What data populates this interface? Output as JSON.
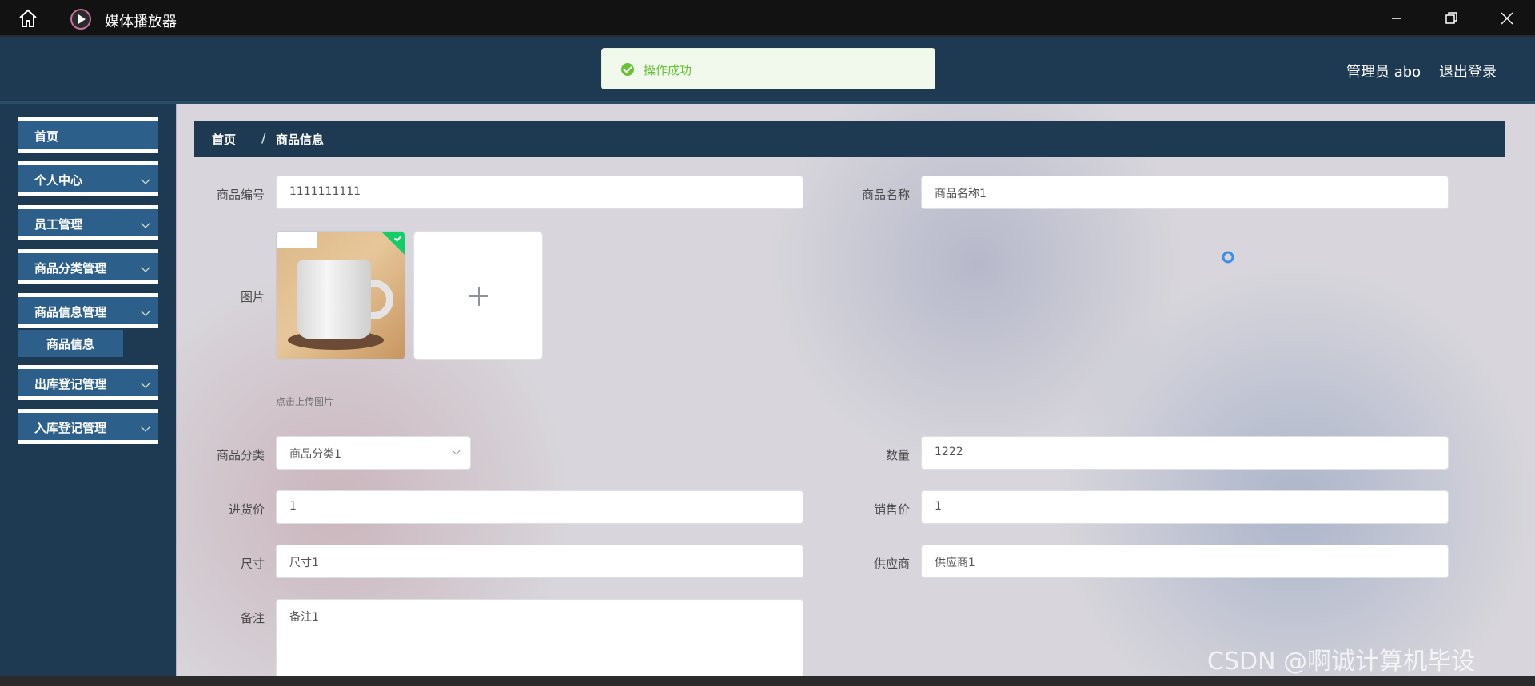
{
  "window": {
    "title": "媒体播放器"
  },
  "header": {
    "toast": "操作成功",
    "user": "管理员 abo",
    "logout": "退出登录"
  },
  "sidebar": {
    "items": [
      {
        "label": "首页"
      },
      {
        "label": "个人中心"
      },
      {
        "label": "员工管理"
      },
      {
        "label": "商品分类管理"
      },
      {
        "label": "商品信息管理"
      },
      {
        "label": "出库登记管理"
      },
      {
        "label": "入库登记管理"
      }
    ],
    "sub": "商品信息"
  },
  "breadcrumb": {
    "home": "首页",
    "sep": "/",
    "current": "商品信息"
  },
  "form": {
    "code_label": "商品编号",
    "code_value": "1111111111",
    "name_label": "商品名称",
    "name_value": "商品名称1",
    "image_label": "图片",
    "upload_hint": "点击上传图片",
    "category_label": "商品分类",
    "category_value": "商品分类1",
    "qty_label": "数量",
    "qty_value": "1222",
    "purchase_label": "进货价",
    "purchase_value": "1",
    "sale_label": "销售价",
    "sale_value": "1",
    "size_label": "尺寸",
    "size_value": "尺寸1",
    "supplier_label": "供应商",
    "supplier_value": "供应商1",
    "remark_label": "备注",
    "remark_value": "备注1"
  },
  "watermark": "CSDN @啊诚计算机毕设",
  "colors": {
    "sidebar": "#1e3a52",
    "menu": "#2c5f8a",
    "success": "#67c23a"
  }
}
